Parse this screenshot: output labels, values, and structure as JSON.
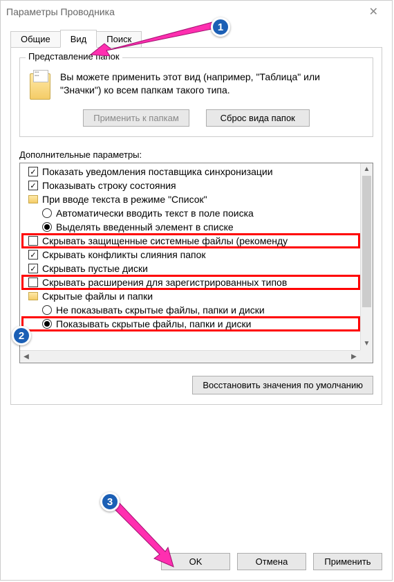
{
  "window": {
    "title": "Параметры Проводника"
  },
  "tabs": {
    "general": "Общие",
    "view": "Вид",
    "search": "Поиск"
  },
  "folderViews": {
    "legend": "Представление папок",
    "description": "Вы можете применить этот вид (например, \"Таблица\" или \"Значки\") ко всем папкам такого типа.",
    "applyBtn": "Применить к папкам",
    "resetBtn": "Сброс вида папок"
  },
  "advanced": {
    "label": "Дополнительные параметры:",
    "restoreBtn": "Восстановить значения по умолчанию",
    "items": [
      {
        "type": "check",
        "checked": true,
        "indent": 1,
        "text": "Показать уведомления поставщика синхронизации"
      },
      {
        "type": "check",
        "checked": true,
        "indent": 1,
        "text": "Показывать строку состояния"
      },
      {
        "type": "folder",
        "indent": 1,
        "text": "При вводе текста в режиме \"Список\""
      },
      {
        "type": "radio",
        "checked": false,
        "indent": 2,
        "text": "Автоматически вводить текст в поле поиска"
      },
      {
        "type": "radio",
        "checked": true,
        "indent": 2,
        "text": "Выделять введенный элемент в списке"
      },
      {
        "type": "check",
        "checked": false,
        "indent": 1,
        "text": "Скрывать защищенные системные файлы (рекоменду",
        "hl": true
      },
      {
        "type": "check",
        "checked": true,
        "indent": 1,
        "text": "Скрывать конфликты слияния папок"
      },
      {
        "type": "check",
        "checked": true,
        "indent": 1,
        "text": "Скрывать пустые диски"
      },
      {
        "type": "check",
        "checked": false,
        "indent": 1,
        "text": "Скрывать расширения для зарегистрированных типов",
        "hl": true
      },
      {
        "type": "folder",
        "indent": 1,
        "text": "Скрытые файлы и папки"
      },
      {
        "type": "radio",
        "checked": false,
        "indent": 2,
        "text": "Не показывать скрытые файлы, папки и диски"
      },
      {
        "type": "radio",
        "checked": true,
        "indent": 2,
        "text": "Показывать скрытые файлы, папки и диски",
        "hl": true
      }
    ]
  },
  "buttons": {
    "ok": "OK",
    "cancel": "Отмена",
    "apply": "Применить"
  },
  "annotations": {
    "badge1": "1",
    "badge2": "2",
    "badge3": "3"
  }
}
